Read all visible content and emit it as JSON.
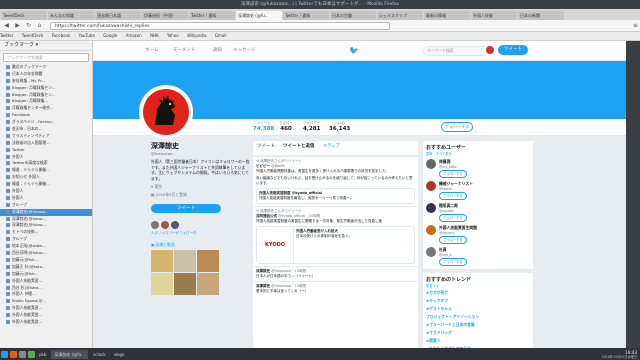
{
  "window": {
    "title": "深澤諒史 (@fukazawa...) | Twitterでも日本はサポートが… - Mozilla Firefox"
  },
  "tabs": [
    {
      "label": "TweetDeck"
    },
    {
      "label": "みんなの知識"
    },
    {
      "label": "過去期日本語"
    },
    {
      "label": "伊藤由紀（中国）"
    },
    {
      "label": "Twitter / 通知"
    },
    {
      "label": "深澤諒史 (@fu..."
    },
    {
      "label": "Twitter / 通知"
    },
    {
      "label": "日本の労働"
    },
    {
      "label": "シェルスクリプ"
    },
    {
      "label": "最新の情報"
    },
    {
      "label": "外国人技能"
    },
    {
      "label": "日本の新聞"
    }
  ],
  "nav": {
    "url": "https://twitter.com/fukazawashishi_replies"
  },
  "bookmarks_bar": [
    "Twitter",
    "TweetDeck",
    "Facebook",
    "YouTube",
    "Google",
    "Amazon",
    "NHK",
    "Yahoo",
    "Wikipedia",
    "Gmail"
  ],
  "sidebar": {
    "title": "ブックマーク ▾",
    "search_placeholder": "ブックマークを検索",
    "items": [
      {
        "label": "最近のブックマーク"
      },
      {
        "label": "日本人の年金問題"
      },
      {
        "label": "安倍政権 - My Pr..."
      },
      {
        "label": "Blogger: 月曜政権セン..."
      },
      {
        "label": "Blogger: 月曜政権セン..."
      },
      {
        "label": "Blogger: 月曜政権..."
      },
      {
        "label": "月曜政権センター総合..."
      },
      {
        "label": "Facebook"
      },
      {
        "label": "グラスペイジ - Faceno..."
      },
      {
        "label": "金沢市 - 日本の..."
      },
      {
        "label": "クラスティンペディア"
      },
      {
        "label": "法務省の出入国管理..."
      },
      {
        "label": "Twitter"
      },
      {
        "label": "外国人"
      },
      {
        "label": "Twitterの高度な検索"
      },
      {
        "label": "報道 - ぐらぐら開催..."
      },
      {
        "label": "お知らせ 外国人"
      },
      {
        "label": "報道 - ぐらぐら開催..."
      },
      {
        "label": "外国人"
      },
      {
        "label": "外国人"
      },
      {
        "label": "グループ"
      },
      {
        "label": "深澤諒史(@fukaza...",
        "selected": true
      },
      {
        "label": "深澤諒史(@fukaz..."
      },
      {
        "label": "深澤諒史(@fukaz..."
      },
      {
        "label": "モトベの技術..."
      },
      {
        "label": "グループ"
      },
      {
        "label": "地本正則(@wata..."
      },
      {
        "label": "西谷芳明(@fukaz..."
      },
      {
        "label": "加藤元(@fuk..."
      },
      {
        "label": "加藤正 杉(@kato..."
      },
      {
        "label": "加藤元(@fuk..."
      },
      {
        "label": "外国人技能実習..."
      },
      {
        "label": "西谷 杉(@kato..."
      },
      {
        "label": "外国人 仲間..."
      },
      {
        "label": "Shoko Egawa(@..."
      },
      {
        "label": "外国人技能実習..."
      },
      {
        "label": "外国人技能実習..."
      },
      {
        "label": "外国人技能実習..."
      }
    ]
  },
  "twitter_nav": {
    "home": "ホーム",
    "moments": "モーメント",
    "notifications": "通知",
    "messages": "メッセージ",
    "search_placeholder": "キーワード検索",
    "tweet_button": "ツイート"
  },
  "profile_stats": [
    {
      "label": "ツイート",
      "value": "74,388"
    },
    {
      "label": "フォロー",
      "value": "460"
    },
    {
      "label": "フォロワー",
      "value": "4,281"
    },
    {
      "label": "いいね",
      "value": "36,143"
    }
  ],
  "follow_button": "フォローする",
  "profile": {
    "name": "深澤諒史",
    "handle": "@fukazawa",
    "bio": "外国人（第三国労働者日本）アイコンはフォロワーの一枚です。また外国人ジャーナリストと共同執筆をしています。主にウェブやシステムの開発。今はいろいろ気にしてます。",
    "location": "東京",
    "joined": "2010年6月に登録",
    "tweet_button": "ツイート",
    "followers_you_know": "人のフォロワーがフォロー中",
    "media_label": "画像と動画"
  },
  "timeline": {
    "tabs": [
      "ツイート",
      "ツイートと返信",
      "メディア"
    ],
    "tweets": [
      {
        "meta": "深澤諒史さんがリツイート",
        "author": "ビビビー",
        "handle": "@BibiBi",
        "text": "外国人労働者問題特集は、実習生を数多く受け入れる介護現場での状況を見ました。"
      },
      {
        "meta": "",
        "author": "",
        "handle": "",
        "text": "深い議論などでもないけれど、話を受け止めるのを繰り返して、何が起こっているのか考えたいと思います。"
      },
      {
        "meta": "",
        "author": "外国人技能実習制度 @kyodo_official",
        "handle": "",
        "text": "外国人技能実習制度を報告し、実態を一つ一つ見て改善へ。"
      },
      {
        "meta": "深澤諒史さんがリツイート",
        "author": "共同通信公式",
        "handle": "@kyodo_official · 10時間",
        "text": "外国人技能実習制度の実習生に関連する一次対象、厚生労働省が出した見直し案"
      },
      {
        "meta": "",
        "author": "外国人労働者受け入れ拡大",
        "handle": "",
        "text": "日本の受け入れ体制の強化を急ぐ。"
      },
      {
        "meta": "",
        "author": "深澤諒史",
        "handle": "@fukazawa · 10時間",
        "text": "日本人が日本語の中で…（ツイート）"
      },
      {
        "meta": "",
        "author": "深澤諒史",
        "handle": "@fukazawa · 10時間",
        "text": "基本的に不幸は言ってくれ（ー）"
      }
    ],
    "kyodo_logo": "KYODO"
  },
  "right_column": {
    "who_to_follow_title": "おすすめユーザー",
    "who_to_follow_links": "更新 · すべて表示",
    "users": [
      {
        "name": "齊藤潤",
        "handle": "@jun_saito"
      },
      {
        "name": "機械ジャーナリスト",
        "handle": "@koshin"
      },
      {
        "name": "穂坂真二郎",
        "handle": "@hosaka"
      },
      {
        "name": "外国人技能実習生問題",
        "handle": "@jitsushu"
      },
      {
        "name": "社員",
        "handle": "@sha_in"
      }
    ],
    "follow_label": "フォローする",
    "trends_title": "おすすめのトレンド",
    "trends_change": "変更する",
    "trends": [
      {
        "tag": "#ガガが死亡",
        "count": ""
      },
      {
        "tag": "#キックオフ",
        "count": ""
      },
      {
        "tag": "#ゲストちゃん",
        "count": ""
      },
      {
        "tag": "プロジェクト・アリゾーション",
        "count": ""
      },
      {
        "tag": "#ブルーバードと日本の言葉",
        "count": ""
      },
      {
        "tag": "#マクドバッグ",
        "count": ""
      },
      {
        "tag": "#関東人",
        "count": ""
      },
      {
        "tag": "#あなたとのすたすの日々",
        "count": ""
      },
      {
        "tag": "#オタクの終わり",
        "count": ""
      }
    ]
  },
  "taskbar": {
    "items": [
      "pkb",
      "深澤諒史 (@fu...",
      "xclock",
      "xlogo"
    ],
    "clock": "16:43",
    "date": "2018年10月03日水曜日"
  }
}
